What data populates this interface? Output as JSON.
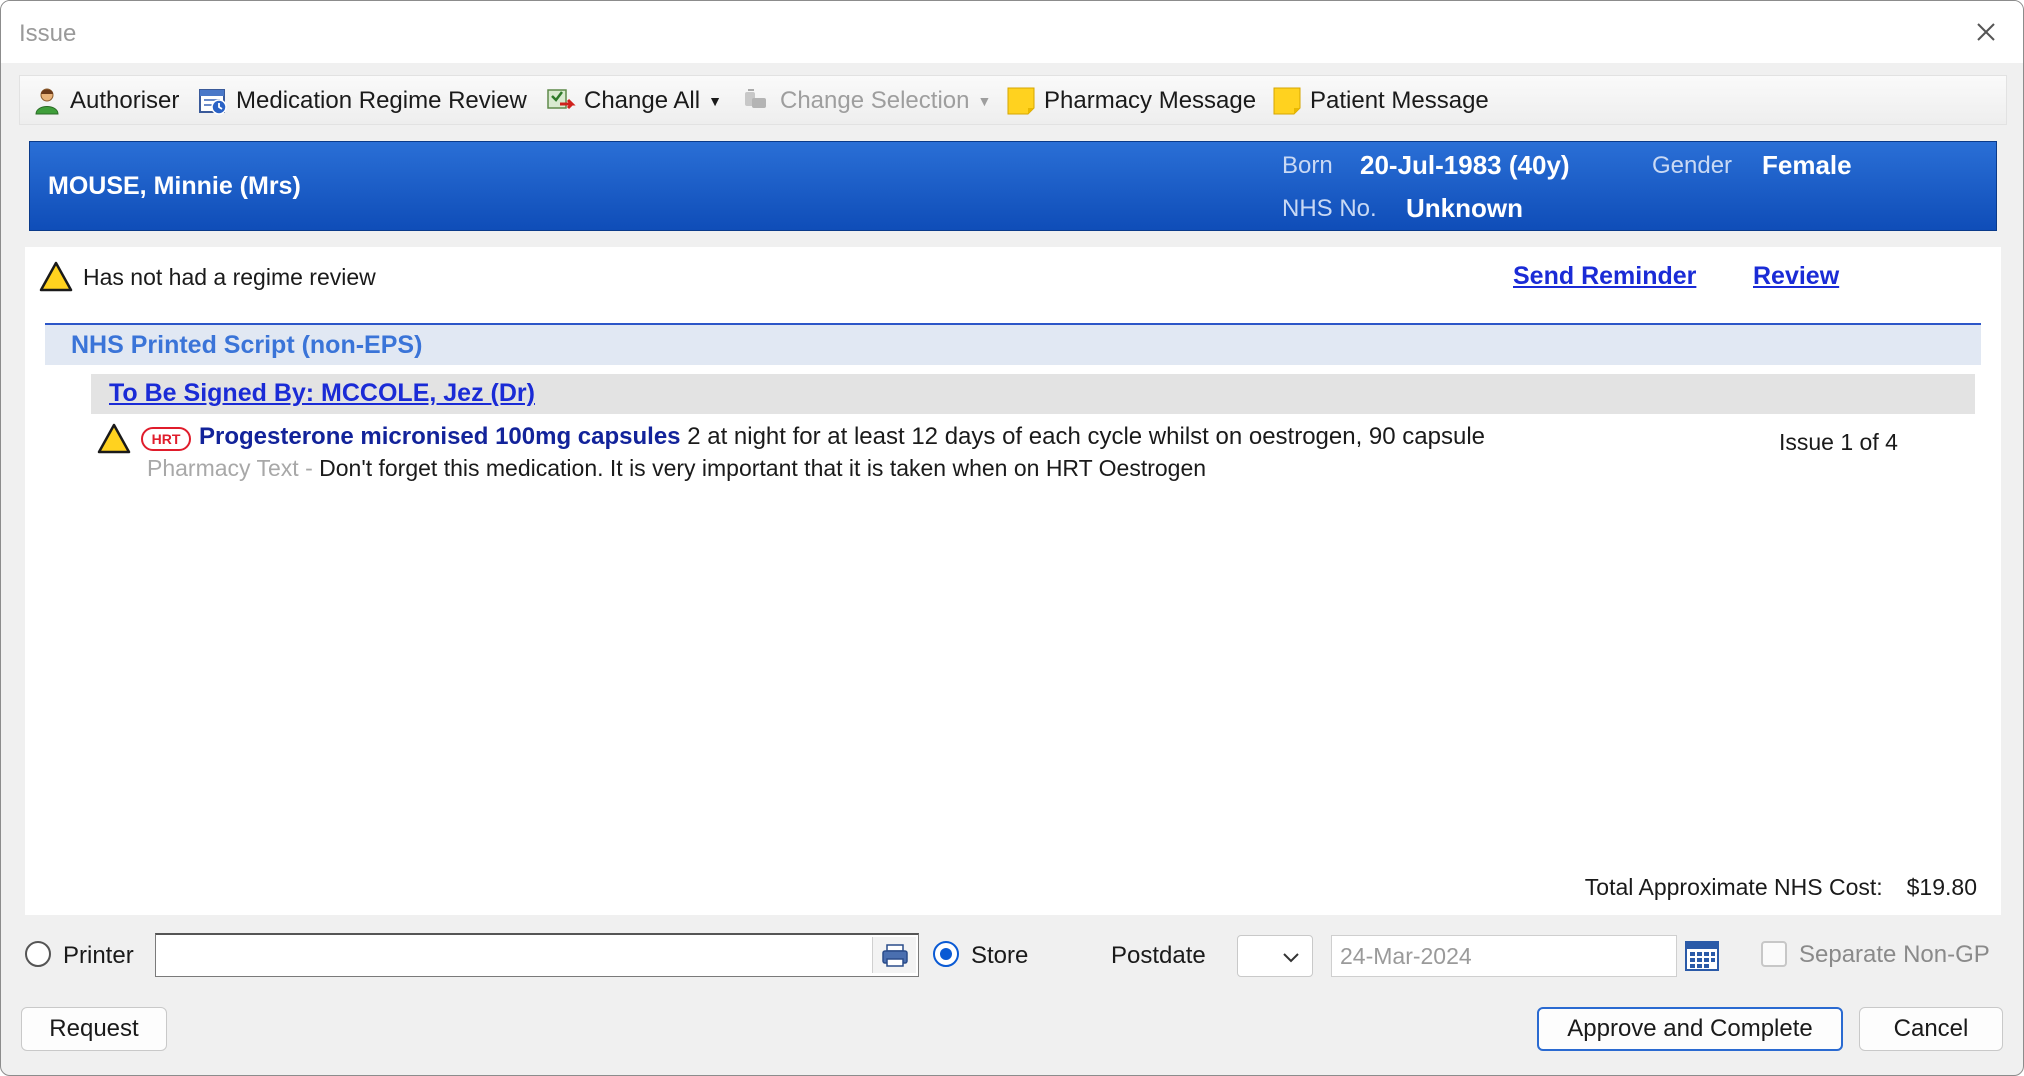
{
  "window": {
    "title": "Issue"
  },
  "toolbar": {
    "authoriser": "Authoriser",
    "medication_review": "Medication Regime Review",
    "change_all": "Change All",
    "change_selection": "Change Selection",
    "pharmacy_message": "Pharmacy Message",
    "patient_message": "Patient Message"
  },
  "patient": {
    "name": "MOUSE, Minnie (Mrs)",
    "born_label": "Born",
    "born_value": "20-Jul-1983 (40y)",
    "gender_label": "Gender",
    "gender_value": "Female",
    "nhs_label": "NHS No.",
    "nhs_value": "Unknown"
  },
  "review_banner": {
    "text": "Has not had a regime review",
    "send_reminder": "Send Reminder",
    "review": "Review"
  },
  "script": {
    "title": "NHS Printed Script (non-EPS)",
    "signed_by": "To Be Signed By: MCCOLE, Jez (Dr)",
    "items": [
      {
        "badge": "HRT",
        "name": "Progesterone micronised 100mg capsules",
        "dosage": "2 at night for at least 12 days of each cycle whilst on oestrogen, 90 capsule",
        "pharmacy_label": "Pharmacy Text -",
        "pharmacy_text": "Don't forget this medication. It is very important that it is taken when on HRT Oestrogen",
        "issue": "Issue 1 of 4"
      }
    ],
    "total_label": "Total Approximate NHS Cost:",
    "total_value": "$19.80"
  },
  "footer": {
    "printer_label": "Printer",
    "printer_value": "",
    "store_label": "Store",
    "postdate_label": "Postdate",
    "postdate_date": "24-Mar-2024",
    "separate_label": "Separate Non-GP",
    "request_button": "Request",
    "approve_button": "Approve and Complete",
    "cancel_button": "Cancel"
  },
  "colors": {
    "banner_blue": "#1656c4",
    "link_blue": "#1a2bd6",
    "hrt_red": "#e01c2b",
    "warning_yellow": "#ffd21f"
  },
  "icons": [
    "authoriser-icon",
    "medication-review-icon",
    "change-all-icon",
    "change-selection-icon",
    "pharmacy-message-icon",
    "patient-message-icon",
    "warning-icon",
    "printer-icon",
    "calendar-icon",
    "close-icon"
  ]
}
